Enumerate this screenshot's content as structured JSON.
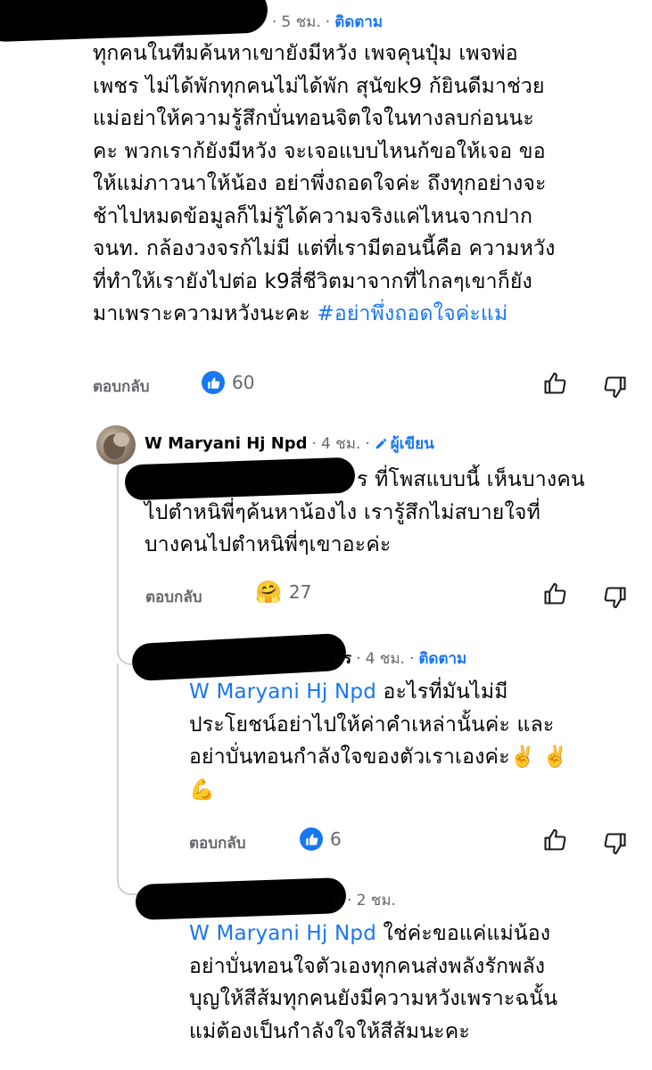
{
  "comment1": {
    "time": "5 ชม.",
    "follow": "ติดตาม",
    "lines": [
      "ทุกคนในทีมค้นหาเขายังมีหวัง  เพจคุนปุ๋ม เพจพ่อ",
      "เพชร ไม่ได้พักทุกคนไม่ได้พัก สุนัขk9 ก้ยินดีมาช่วย",
      "แม่อย่าให้ความรู้สึกบั่นทอนจิตใจในทางลบก่อนนะ",
      "คะ พวกเราก้ยังมีหวัง จะเจอแบบไหนก้ขอให้เจอ ขอ",
      "ให้แม่ภาวนาให้น้อง อย่าพึ่งถอดใจค่ะ  ถึงทุกอย่างจะ",
      "ช้าไปหมดข้อมูลก็ไม่รู้ได้ความจริงแค่ไหนจากปาก",
      "จนท. กล้องวงจรก้ไม่มี แต่ที่เรามีตอนนี้คือ ความหวัง",
      "ที่ทำให้เรายังไปต่อ k9สี่ชีวิตมาจากที่ไกลๆเขาก็ยัง"
    ],
    "last_line": "มาเพราะความหวังนะคะ ",
    "hashtag": "#อย่าพึ่งถอดใจค่ะแม่",
    "reply": "ตอบกลับ",
    "likes": "60"
  },
  "comment2": {
    "name": "W Maryani Hj Npd",
    "time": "4 ชม.",
    "author_badge": "ผู้เขียน",
    "first_line_suffix": "ร ที่โพสแบบนี้ เห็นบางคน",
    "lines": [
      "ไปตำหนิพี่ๆค้นหาน้องไง เรารู้สึกไม่สบายใจที่",
      "บางคนไปตำหนิพี่ๆเขาอะค่ะ"
    ],
    "reply": "ตอบกลับ",
    "reactions": "27"
  },
  "comment3": {
    "name_suffix": "ตร",
    "time": "4 ชม.",
    "follow": "ติดตาม",
    "mention": "W Maryani Hj Npd",
    "first_line_rest": " อะไรที่มันไม่มี",
    "lines": [
      "ประโยชน์อย่าไปให้ค่าคำเหล่านั้นค่ะ และ",
      "อย่าบั่นทอนกำลังใจของตัวเราเองค่ะ✌️ ✌️",
      "💪"
    ],
    "reply": "ตอบกลับ",
    "likes": "6"
  },
  "comment4": {
    "name_suffix": "g",
    "time": "2 ชม.",
    "mention": "W Maryani Hj Npd",
    "first_line_rest": " ใช่ค่ะขอแค่แม่น้อง",
    "lines": [
      "อย่าบั่นทอนใจตัวเองทุกคนส่งพลังรักพลัง",
      "บุญให้สีส้มทุกคนยังมีความหวังเพราะฉนั้น",
      "แม่ต้องเป็นกำลังใจให้สีส้มนะคะ"
    ]
  },
  "colors": {
    "accent": "#1877f2",
    "muted": "#65676b",
    "thread": "#ced0d4"
  }
}
